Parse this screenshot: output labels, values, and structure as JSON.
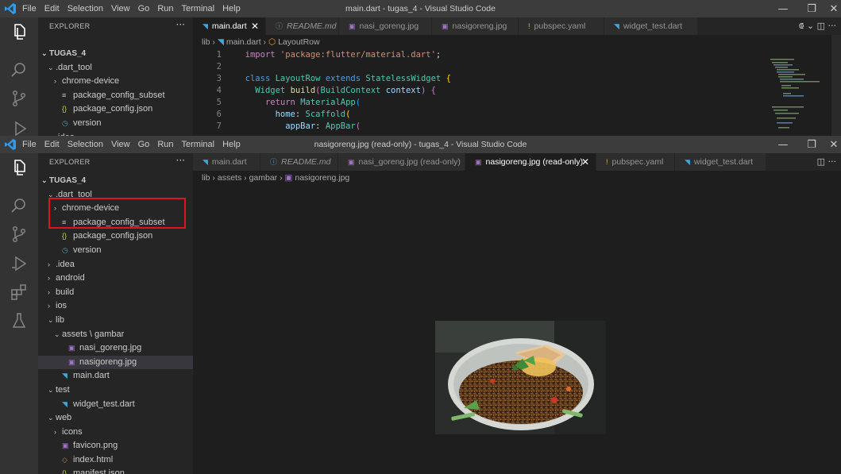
{
  "window1": {
    "menu": [
      "File",
      "Edit",
      "Selection",
      "View",
      "Go",
      "Run",
      "Terminal",
      "Help"
    ],
    "title": "main.dart - tugas_4 - Visual Studio Code",
    "explorer_title": "EXPLORER",
    "explorer_more": "···",
    "tree": [
      {
        "label": "TUGAS_4",
        "indent": 0,
        "chevron": "⌄",
        "icon": "",
        "bold": true
      },
      {
        "label": ".dart_tool",
        "indent": 1,
        "chevron": "⌄",
        "icon": ""
      },
      {
        "label": "chrome-device",
        "indent": 2,
        "chevron": "›",
        "icon": ""
      },
      {
        "label": "package_config_subset",
        "indent": 2,
        "chevron": "",
        "icon": "≡"
      },
      {
        "label": "package_config.json",
        "indent": 2,
        "chevron": "",
        "icon": "{}"
      },
      {
        "label": "version",
        "indent": 2,
        "chevron": "",
        "icon": "◷"
      },
      {
        "label": ".idea",
        "indent": 1,
        "chevron": "›",
        "icon": ""
      }
    ],
    "tabs": [
      {
        "label": "main.dart",
        "icon": "◥",
        "active": true,
        "italic": false,
        "width": 92
      },
      {
        "label": "README.md",
        "icon": "ⓘ",
        "active": false,
        "italic": true,
        "width": 92
      },
      {
        "label": "nasi_goreng.jpg",
        "icon": "▣",
        "active": false,
        "italic": false,
        "width": 117
      },
      {
        "label": "nasigoreng.jpg",
        "icon": "▣",
        "active": false,
        "italic": false,
        "width": 109
      },
      {
        "label": "pubspec.yaml",
        "icon": "!",
        "active": false,
        "italic": false,
        "width": 108
      },
      {
        "label": "widget_test.dart",
        "icon": "◥",
        "active": false,
        "italic": false,
        "width": 118
      }
    ],
    "tools": "⟃ ⌄ ◫ ···",
    "breadcrumbs": [
      "lib",
      "main.dart",
      "LayoutRow"
    ],
    "code": [
      {
        "n": "1",
        "tokens": [
          [
            "  ",
            "#d4d4d4"
          ],
          [
            "import",
            "#c586c0"
          ],
          [
            " ",
            "#d4d4d4"
          ],
          [
            "'package:flutter/material.dart'",
            "#ce9178"
          ],
          [
            ";",
            "#d4d4d4"
          ]
        ]
      },
      {
        "n": "2",
        "tokens": []
      },
      {
        "n": "3",
        "tokens": [
          [
            "  ",
            "#d4d4d4"
          ],
          [
            "class",
            "#569cd6"
          ],
          [
            " ",
            "#d4d4d4"
          ],
          [
            "LayoutRow",
            "#4ec9b0"
          ],
          [
            " ",
            "#d4d4d4"
          ],
          [
            "extends",
            "#569cd6"
          ],
          [
            " ",
            "#d4d4d4"
          ],
          [
            "StatelessWidget",
            "#4ec9b0"
          ],
          [
            " {",
            "#ffd700"
          ]
        ]
      },
      {
        "n": "4",
        "tokens": [
          [
            "    ",
            "#d4d4d4"
          ],
          [
            "Widget",
            "#4ec9b0"
          ],
          [
            " ",
            "#d4d4d4"
          ],
          [
            "build",
            "#dcdcaa"
          ],
          [
            "(",
            "#da70d6"
          ],
          [
            "BuildContext",
            "#4ec9b0"
          ],
          [
            " ",
            "#d4d4d4"
          ],
          [
            "context",
            "#9cdcfe"
          ],
          [
            ")",
            "#da70d6"
          ],
          [
            " {",
            "#da70d6"
          ]
        ]
      },
      {
        "n": "5",
        "tokens": [
          [
            "      ",
            "#d4d4d4"
          ],
          [
            "return",
            "#c586c0"
          ],
          [
            " ",
            "#d4d4d4"
          ],
          [
            "MaterialApp",
            "#4ec9b0"
          ],
          [
            "(",
            "#179fff"
          ]
        ]
      },
      {
        "n": "6",
        "tokens": [
          [
            "        ",
            "#d4d4d4"
          ],
          [
            "home",
            "#9cdcfe"
          ],
          [
            ": ",
            "#d4d4d4"
          ],
          [
            "Scaffold",
            "#4ec9b0"
          ],
          [
            "(",
            "#ffd700"
          ]
        ]
      },
      {
        "n": "7",
        "tokens": [
          [
            "          ",
            "#d4d4d4"
          ],
          [
            "appBar",
            "#9cdcfe"
          ],
          [
            ": ",
            "#d4d4d4"
          ],
          [
            "AppBar",
            "#4ec9b0"
          ],
          [
            "(",
            "#da70d6"
          ]
        ]
      }
    ]
  },
  "window2": {
    "menu": [
      "File",
      "Edit",
      "Selection",
      "View",
      "Go",
      "Run",
      "Terminal",
      "Help"
    ],
    "title": "nasigoreng.jpg (read-only) - tugas_4 - Visual Studio Code",
    "explorer_title": "EXPLORER",
    "explorer_more": "···",
    "tree": [
      {
        "label": "TUGAS_4",
        "indent": 0,
        "chevron": "⌄",
        "icon": "",
        "bold": true
      },
      {
        "label": ".dart_tool",
        "indent": 1,
        "chevron": "⌄",
        "icon": ""
      },
      {
        "label": "chrome-device",
        "indent": 2,
        "chevron": "›",
        "icon": ""
      },
      {
        "label": "package_config_subset",
        "indent": 2,
        "chevron": "",
        "icon": "≡"
      },
      {
        "label": "package_config.json",
        "indent": 2,
        "chevron": "",
        "icon": "{}"
      },
      {
        "label": "version",
        "indent": 2,
        "chevron": "",
        "icon": "◷"
      },
      {
        "label": ".idea",
        "indent": 1,
        "chevron": "›",
        "icon": ""
      },
      {
        "label": "android",
        "indent": 1,
        "chevron": "›",
        "icon": ""
      },
      {
        "label": "build",
        "indent": 1,
        "chevron": "›",
        "icon": ""
      },
      {
        "label": "ios",
        "indent": 1,
        "chevron": "›",
        "icon": ""
      },
      {
        "label": "lib",
        "indent": 1,
        "chevron": "⌄",
        "icon": ""
      },
      {
        "label": "assets \\ gambar",
        "indent": 2,
        "chevron": "⌄",
        "icon": ""
      },
      {
        "label": "nasi_goreng.jpg",
        "indent": 3,
        "chevron": "",
        "icon": "▣"
      },
      {
        "label": "nasigoreng.jpg",
        "indent": 3,
        "chevron": "",
        "icon": "▣",
        "selected": true
      },
      {
        "label": "main.dart",
        "indent": 2,
        "chevron": "",
        "icon": "◥"
      },
      {
        "label": "test",
        "indent": 1,
        "chevron": "⌄",
        "icon": ""
      },
      {
        "label": "widget_test.dart",
        "indent": 2,
        "chevron": "",
        "icon": "◥"
      },
      {
        "label": "web",
        "indent": 1,
        "chevron": "⌄",
        "icon": ""
      },
      {
        "label": "icons",
        "indent": 2,
        "chevron": "›",
        "icon": ""
      },
      {
        "label": "favicon.png",
        "indent": 2,
        "chevron": "",
        "icon": "▣"
      },
      {
        "label": "index.html",
        "indent": 2,
        "chevron": "",
        "icon": "◇"
      },
      {
        "label": "manifest.json",
        "indent": 2,
        "chevron": "",
        "icon": "{}"
      }
    ],
    "tabs": [
      {
        "label": "main.dart",
        "icon": "◥",
        "active": false,
        "italic": false,
        "width": 85
      },
      {
        "label": "README.md",
        "icon": "ⓘ",
        "active": false,
        "italic": true,
        "width": 98
      },
      {
        "label": "nasi_goreng.jpg (read-only)",
        "icon": "▣",
        "active": false,
        "italic": false,
        "width": 160
      },
      {
        "label": "nasigoreng.jpg (read-only)",
        "icon": "▣",
        "active": true,
        "italic": false,
        "width": 165
      },
      {
        "label": "pubspec.yaml",
        "icon": "!",
        "active": false,
        "italic": false,
        "width": 99
      },
      {
        "label": "widget_test.dart",
        "icon": "◥",
        "active": false,
        "italic": false,
        "width": 115
      }
    ],
    "tools": "◫ ···",
    "breadcrumbs": [
      "lib",
      "assets",
      "gambar",
      "nasigoreng.jpg"
    ]
  },
  "colors": {
    "dart_icon": "#41a6dc",
    "image_icon": "#a074c4",
    "json_icon": "#cbcb41",
    "yaml_icon": "#e8b84b",
    "html_icon": "#e37933",
    "info_icon": "#519aba",
    "highlight_box": "#e0141e"
  }
}
